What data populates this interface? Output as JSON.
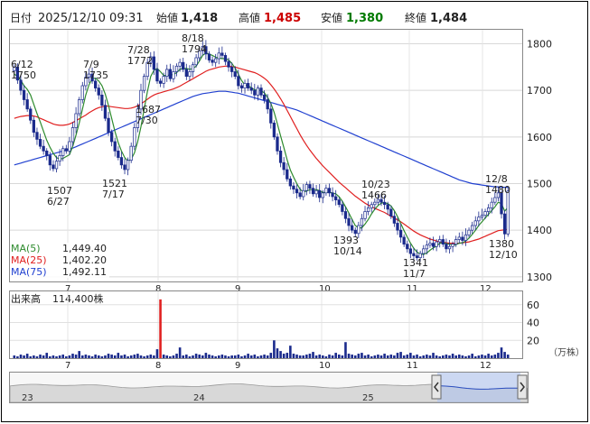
{
  "header": {
    "date_label": "日付",
    "datetime": "2025/12/10 09:31",
    "open_label": "始値",
    "open_value": "1,418",
    "high_label": "高値",
    "high_value": "1,485",
    "low_label": "安値",
    "low_value": "1,380",
    "close_label": "終値",
    "close_value": "1,484"
  },
  "colors": {
    "candle_up": "#ffffff",
    "candle_down": "#1a2a8c",
    "ma5": "#2e8b2e",
    "ma25": "#e02020",
    "ma75": "#2040d0",
    "volume": "#1a2a8c",
    "volume_highlight": "#e02020",
    "high_red": "#cc0000",
    "low_green": "#007a00"
  },
  "legend": [
    {
      "name": "MA(5)",
      "value": "1,449.40",
      "color": "#2e8b2e"
    },
    {
      "name": "MA(25)",
      "value": "1,402.20",
      "color": "#e02020"
    },
    {
      "name": "MA(75)",
      "value": "1,492.11",
      "color": "#2040d0"
    }
  ],
  "volume_header": {
    "label": "出来高",
    "value": "114,400株"
  },
  "volume_unit": "（万株）",
  "chart_data": {
    "type": "candlestick",
    "ylim": [
      1290,
      1830
    ],
    "y_ticks": [
      "1800",
      "1700",
      "1600",
      "1500",
      "1400",
      "1300"
    ],
    "x_ticks": [
      "7",
      "8",
      "9",
      "10",
      "11",
      "12"
    ],
    "annotations": [
      {
        "date": "6/12",
        "value": "1750"
      },
      {
        "date": "7/9",
        "value": "1735"
      },
      {
        "date": "7/28",
        "value": "1772"
      },
      {
        "date": "8/18",
        "value": "1794"
      },
      {
        "date": "7/30",
        "value": "1687"
      },
      {
        "date": "6/27",
        "value": "1507"
      },
      {
        "date": "7/17",
        "value": "1521"
      },
      {
        "date": "10/23",
        "value": "1466"
      },
      {
        "date": "10/14",
        "value": "1393"
      },
      {
        "date": "11/7",
        "value": "1341"
      },
      {
        "date": "12/8",
        "value": "1480"
      },
      {
        "date": "12/10",
        "value": "1380"
      }
    ],
    "close": [
      1750,
      1722,
      1700,
      1680,
      1660,
      1636,
      1610,
      1595,
      1580,
      1570,
      1560,
      1540,
      1532,
      1548,
      1560,
      1575,
      1570,
      1590,
      1620,
      1650,
      1680,
      1710,
      1728,
      1735,
      1720,
      1705,
      1690,
      1668,
      1640,
      1610,
      1590,
      1570,
      1556,
      1540,
      1530,
      1550,
      1580,
      1620,
      1660,
      1700,
      1730,
      1760,
      1772,
      1745,
      1720,
      1715,
      1730,
      1745,
      1725,
      1740,
      1752,
      1760,
      1745,
      1730,
      1740,
      1755,
      1770,
      1785,
      1794,
      1778,
      1765,
      1760,
      1768,
      1780,
      1775,
      1762,
      1750,
      1740,
      1730,
      1710,
      1705,
      1715,
      1705,
      1700,
      1690,
      1705,
      1690,
      1680,
      1660,
      1630,
      1600,
      1570,
      1545,
      1530,
      1510,
      1495,
      1488,
      1480,
      1472,
      1485,
      1498,
      1490,
      1478,
      1485,
      1470,
      1480,
      1490,
      1480,
      1472,
      1465,
      1455,
      1440,
      1425,
      1410,
      1400,
      1393,
      1410,
      1425,
      1440,
      1448,
      1455,
      1460,
      1466,
      1460,
      1455,
      1445,
      1430,
      1415,
      1400,
      1385,
      1370,
      1360,
      1350,
      1345,
      1341,
      1350,
      1360,
      1368,
      1372,
      1365,
      1375,
      1380,
      1370,
      1360,
      1365,
      1370,
      1380,
      1385,
      1378,
      1390,
      1400,
      1410,
      1420,
      1428,
      1432,
      1440,
      1448,
      1460,
      1470,
      1480,
      1435,
      1392,
      1484
    ],
    "ma5": [
      1735,
      1730,
      1722,
      1710,
      1702,
      1690,
      1670,
      1650,
      1632,
      1612,
      1593,
      1578,
      1565,
      1556,
      1552,
      1554,
      1558,
      1562,
      1580,
      1604,
      1630,
      1660,
      1690,
      1712,
      1725,
      1726,
      1720,
      1710,
      1692,
      1668,
      1640,
      1612,
      1588,
      1570,
      1556,
      1548,
      1552,
      1566,
      1590,
      1622,
      1660,
      1698,
      1730,
      1743,
      1747,
      1740,
      1732,
      1732,
      1733,
      1734,
      1738,
      1745,
      1747,
      1747,
      1745,
      1747,
      1752,
      1763,
      1775,
      1780,
      1778,
      1775,
      1771,
      1769,
      1768,
      1768,
      1765,
      1758,
      1748,
      1735,
      1721,
      1712,
      1710,
      1706,
      1701,
      1701,
      1699,
      1695,
      1685,
      1672,
      1653,
      1628,
      1602,
      1577,
      1551,
      1529,
      1514,
      1500,
      1488,
      1482,
      1484,
      1487,
      1487,
      1487,
      1485,
      1481,
      1481,
      1481,
      1480,
      1478,
      1472,
      1462,
      1450,
      1437,
      1423,
      1410,
      1405,
      1405,
      1413,
      1423,
      1435,
      1445,
      1453,
      1458,
      1459,
      1457,
      1452,
      1442,
      1429,
      1414,
      1399,
      1385,
      1372,
      1361,
      1353,
      1349,
      1348,
      1351,
      1357,
      1362,
      1366,
      1372,
      1373,
      1371,
      1370,
      1368,
      1369,
      1372,
      1373,
      1377,
      1383,
      1391,
      1400,
      1410,
      1418,
      1426,
      1434,
      1442,
      1450,
      1460,
      1457,
      1441,
      1449
    ],
    "ma25": [
      1640,
      1642,
      1644,
      1645,
      1646,
      1646,
      1645,
      1643,
      1640,
      1637,
      1634,
      1631,
      1628,
      1626,
      1625,
      1625,
      1626,
      1628,
      1631,
      1635,
      1639,
      1643,
      1647,
      1652,
      1656,
      1660,
      1663,
      1665,
      1666,
      1666,
      1665,
      1664,
      1663,
      1662,
      1661,
      1661,
      1662,
      1664,
      1667,
      1671,
      1676,
      1681,
      1686,
      1690,
      1693,
      1695,
      1697,
      1699,
      1701,
      1703,
      1706,
      1709,
      1713,
      1717,
      1721,
      1725,
      1729,
      1733,
      1737,
      1741,
      1744,
      1746,
      1748,
      1750,
      1751,
      1752,
      1752,
      1751,
      1750,
      1748,
      1746,
      1744,
      1742,
      1740,
      1738,
      1735,
      1731,
      1726,
      1720,
      1712,
      1703,
      1693,
      1682,
      1670,
      1657,
      1644,
      1631,
      1618,
      1605,
      1593,
      1582,
      1572,
      1563,
      1554,
      1546,
      1538,
      1531,
      1524,
      1517,
      1510,
      1503,
      1497,
      1491,
      1485,
      1479,
      1473,
      1468,
      1463,
      1458,
      1454,
      1450,
      1447,
      1444,
      1441,
      1438,
      1434,
      1430,
      1426,
      1422,
      1418,
      1413,
      1408,
      1403,
      1398,
      1394,
      1390,
      1387,
      1384,
      1381,
      1379,
      1377,
      1375,
      1374,
      1373,
      1372,
      1372,
      1372,
      1372,
      1373,
      1374,
      1375,
      1377,
      1379,
      1381,
      1384,
      1387,
      1390,
      1393,
      1396,
      1399,
      1400,
      1401,
      1402
    ],
    "ma75": [
      1540,
      1542,
      1544,
      1546,
      1548,
      1550,
      1552,
      1554,
      1556,
      1558,
      1560,
      1562,
      1564,
      1566,
      1568,
      1570,
      1572,
      1574,
      1576,
      1579,
      1582,
      1585,
      1588,
      1591,
      1594,
      1597,
      1600,
      1603,
      1606,
      1609,
      1612,
      1615,
      1618,
      1621,
      1624,
      1627,
      1630,
      1633,
      1636,
      1639,
      1642,
      1645,
      1648,
      1651,
      1654,
      1657,
      1660,
      1663,
      1666,
      1669,
      1672,
      1675,
      1678,
      1681,
      1684,
      1687,
      1689,
      1691,
      1693,
      1694,
      1695,
      1696,
      1697,
      1698,
      1698,
      1698,
      1697,
      1696,
      1695,
      1694,
      1692,
      1690,
      1688,
      1686,
      1684,
      1682,
      1680,
      1678,
      1676,
      1674,
      1672,
      1670,
      1668,
      1666,
      1664,
      1662,
      1660,
      1658,
      1655,
      1652,
      1649,
      1646,
      1643,
      1640,
      1637,
      1634,
      1631,
      1628,
      1625,
      1622,
      1619,
      1616,
      1613,
      1610,
      1607,
      1604,
      1601,
      1598,
      1595,
      1592,
      1589,
      1586,
      1583,
      1580,
      1577,
      1574,
      1571,
      1568,
      1565,
      1562,
      1559,
      1556,
      1553,
      1550,
      1547,
      1544,
      1541,
      1538,
      1535,
      1532,
      1529,
      1526,
      1523,
      1520,
      1517,
      1514,
      1511,
      1508,
      1506,
      1504,
      1502,
      1500,
      1499,
      1498,
      1497,
      1496,
      1495,
      1494,
      1493,
      1493,
      1492,
      1492,
      1492
    ],
    "volume": [
      3,
      2,
      4,
      3,
      5,
      2,
      3,
      2,
      4,
      3,
      6,
      2,
      3,
      2,
      3,
      4,
      2,
      3,
      5,
      4,
      8,
      3,
      4,
      3,
      2,
      4,
      3,
      2,
      3,
      5,
      4,
      3,
      6,
      3,
      4,
      2,
      3,
      4,
      5,
      3,
      2,
      3,
      4,
      3,
      10,
      66,
      4,
      3,
      2,
      3,
      5,
      12,
      3,
      4,
      2,
      3,
      5,
      4,
      3,
      6,
      4,
      3,
      2,
      3,
      4,
      3,
      2,
      3,
      3,
      4,
      2,
      3,
      5,
      3,
      4,
      2,
      3,
      4,
      3,
      6,
      20,
      11,
      8,
      5,
      6,
      14,
      5,
      4,
      3,
      3,
      4,
      5,
      7,
      3,
      4,
      3,
      2,
      4,
      3,
      6,
      4,
      3,
      18,
      5,
      4,
      3,
      5,
      6,
      3,
      4,
      2,
      3,
      4,
      3,
      5,
      3,
      4,
      3,
      6,
      7,
      3,
      4,
      6,
      3,
      4,
      2,
      3,
      4,
      3,
      6,
      3,
      2,
      3,
      4,
      3,
      5,
      3,
      4,
      3,
      2,
      3,
      5,
      2,
      3,
      4,
      3,
      5,
      3,
      4,
      6,
      12,
      7,
      4
    ],
    "navigator": {
      "labels": [
        "23",
        "24",
        "25"
      ]
    }
  }
}
